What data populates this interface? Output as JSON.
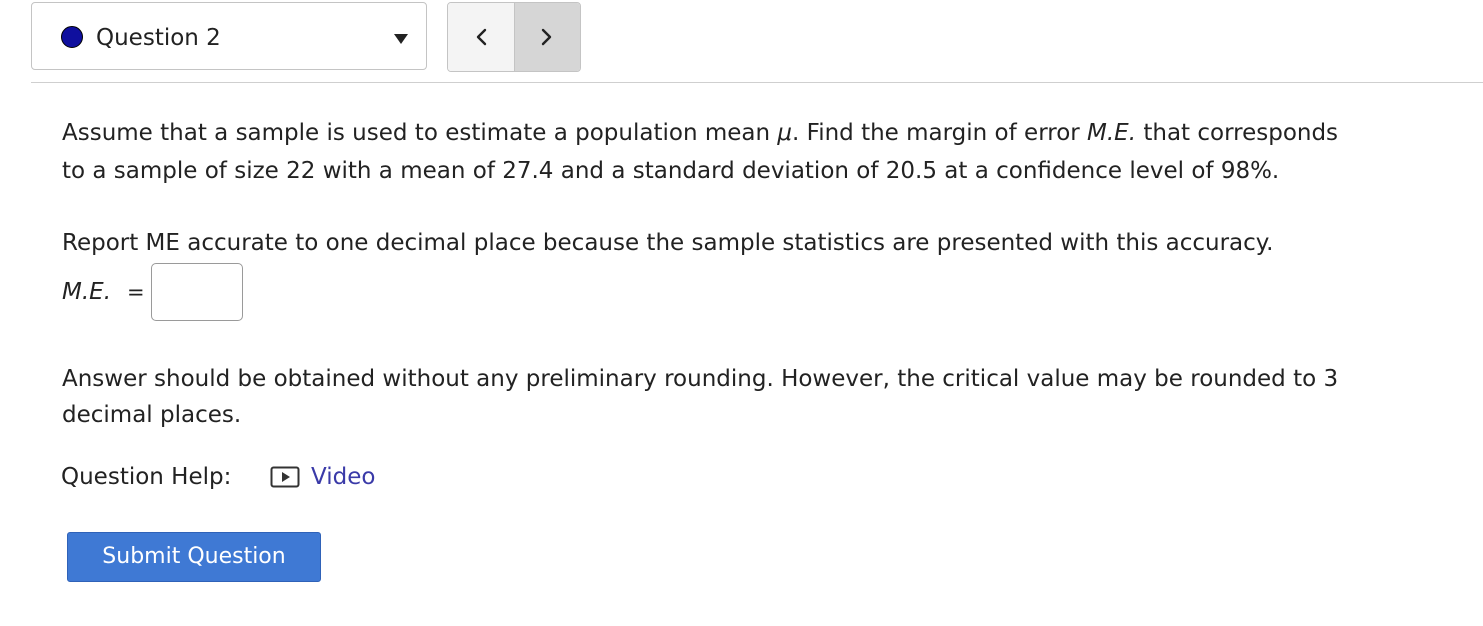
{
  "question_selector": {
    "label": "Question 2",
    "status_color": "#0f0f9e",
    "prev_icon": "chevron-left-icon",
    "next_icon": "chevron-right-icon"
  },
  "question": {
    "paragraph1": {
      "line1_a": "Assume that a sample is used to estimate a population mean ",
      "mu": "μ",
      "line1_b": ". Find the margin of error ",
      "me_italic": "M.E.",
      "line1_c": " that corresponds",
      "line2": "to a sample of size 22 with a mean of 27.4 and a standard deviation of 20.5 at a confidence level of 98%."
    },
    "report_instruction": "Report ME accurate to one decimal place because the sample statistics are presented with this accuracy.",
    "answer_label": "M.E.",
    "answer_equals": "=",
    "answer_value": "",
    "paragraph2_line1": "Answer should be obtained without any preliminary rounding. However, the critical value may be rounded to 3",
    "paragraph2_line2": "decimal places."
  },
  "help": {
    "label": "Question Help:",
    "video_label": "Video",
    "video_icon": "play-video-icon",
    "link_color": "#3a3aa8"
  },
  "submit": {
    "label": "Submit Question",
    "color": "#3f79d4"
  }
}
